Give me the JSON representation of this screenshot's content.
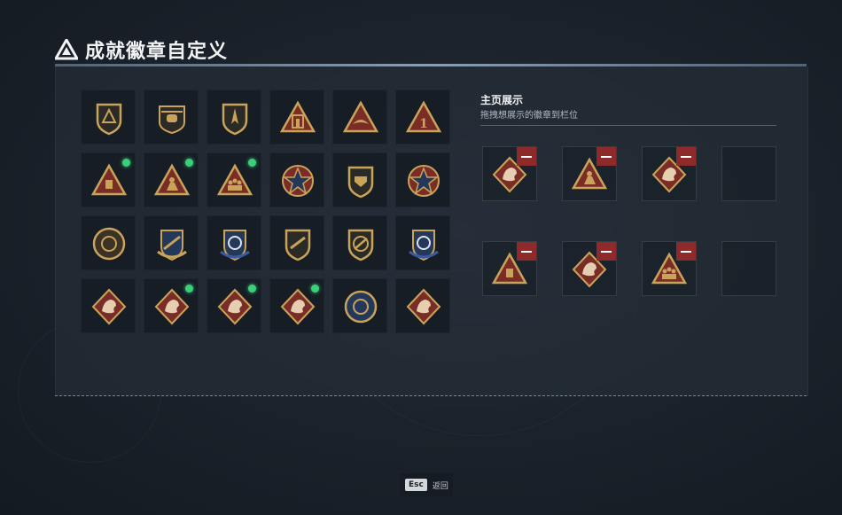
{
  "header": {
    "title": "成就徽章自定义",
    "logo_icon": "triangle-logo-icon"
  },
  "colors": {
    "gold": "#c9a35a",
    "crimson": "#7a2d26",
    "navy": "#23385a",
    "new_dot": "#3ad07a",
    "remove": "#8e2a2a"
  },
  "badges": [
    {
      "icon": "shield-triangle-badge-icon",
      "new": false
    },
    {
      "icon": "helicopter-badge-icon",
      "new": false
    },
    {
      "icon": "shield-jet-badge-icon",
      "new": false
    },
    {
      "icon": "triangle-building-badge-icon",
      "new": false
    },
    {
      "icon": "triangle-wings-badge-icon",
      "new": false
    },
    {
      "icon": "triangle-number-one-badge-icon",
      "new": false
    },
    {
      "icon": "triangle-tower-badge-icon",
      "new": true
    },
    {
      "icon": "triangle-soldier-badge-icon",
      "new": true
    },
    {
      "icon": "triangle-squad-badge-icon",
      "new": true
    },
    {
      "icon": "star-medal-badge-icon",
      "new": false
    },
    {
      "icon": "shield-emblem-badge-icon",
      "new": false
    },
    {
      "icon": "stars-shield-badge-icon",
      "new": false
    },
    {
      "icon": "round-emblem-badge-icon",
      "new": false
    },
    {
      "icon": "crest-rifle-badge-icon",
      "new": false
    },
    {
      "icon": "blue-crest-badge-icon",
      "new": false
    },
    {
      "icon": "shield-rifle-badge-icon",
      "new": false
    },
    {
      "icon": "shield-sniper-badge-icon",
      "new": false
    },
    {
      "icon": "blue-crest-sniper-badge-icon",
      "new": false
    },
    {
      "icon": "diamond-wolf-badge-icon",
      "new": false
    },
    {
      "icon": "diamond-dragon-badge-icon",
      "new": true
    },
    {
      "icon": "diamond-dragon-badge-icon",
      "new": true
    },
    {
      "icon": "diamond-runner-badge-icon",
      "new": true
    },
    {
      "icon": "round-wolf-badge-icon",
      "new": false
    },
    {
      "icon": "diamond-beast-badge-icon",
      "new": false
    }
  ],
  "display": {
    "title": "主页展示",
    "subtitle": "拖拽想展示的徽章到栏位",
    "slots": [
      {
        "icon": "diamond-dragon-badge-icon",
        "filled": true
      },
      {
        "icon": "triangle-soldier-badge-icon",
        "filled": true
      },
      {
        "icon": "diamond-dragon-badge-icon",
        "filled": true
      },
      {
        "icon": "",
        "filled": false
      },
      {
        "icon": "triangle-tower-badge-icon",
        "filled": true
      },
      {
        "icon": "diamond-runner-badge-icon",
        "filled": true
      },
      {
        "icon": "triangle-squad-badge-icon",
        "filled": true
      },
      {
        "icon": "",
        "filled": false
      }
    ]
  },
  "footer": {
    "key": "Esc",
    "label": "返回"
  }
}
